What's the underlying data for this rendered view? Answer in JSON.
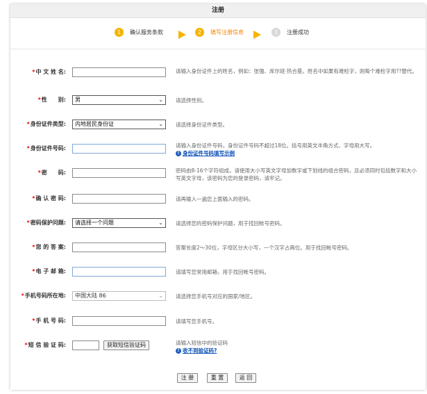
{
  "title": "注册",
  "steps": [
    {
      "num": "1",
      "label": "确认服务条款"
    },
    {
      "num": "2",
      "label": "填写注册信息"
    },
    {
      "num": "3",
      "label": "注册成功"
    }
  ],
  "fields": {
    "name": {
      "label": "中 文 姓 名:",
      "value": "",
      "hint": "请输入身份证件上的姓名，例如：张强、库尔班·热合曼。姓名中如果有难检字，则每个难检字用??替代。"
    },
    "gender": {
      "label": "性　　别:",
      "value": "男",
      "hint": "请选择性别。"
    },
    "id_type": {
      "label": "身份证件类型:",
      "value": "内地居民身份证",
      "hint": "请选择身份证件类型。"
    },
    "id_number": {
      "label": "身份证件号码:",
      "value": "",
      "hint": "请输入身份证件号码，身份证件号码不超过18位。括号用英文半角方式、字母用大写。",
      "link": "身份证件号码填写示例"
    },
    "password": {
      "label": "密　　码:",
      "value": "",
      "hint": "密码由8-16个字符组成，请使用大小写英文字母加数字或下划线的组合密码，且必须同时包括数字和大小写英文字母，该密码为您的登录密码，请牢记。"
    },
    "confirm_password": {
      "label": "确 认 密 码:",
      "value": "",
      "hint": "请再输入一遍您上面输入的密码。"
    },
    "security_question": {
      "label": "密码保护问题:",
      "value": "请选择一个问题",
      "hint": "请选择您的密码保护问题，用于找回帐号密码。"
    },
    "answer": {
      "label": "您 的 答 案:",
      "value": "",
      "hint": "答案长度2～30位，字母区分大小写，一个汉字占两位。用于找回帐号密码。"
    },
    "email": {
      "label": "电 子 邮 箱:",
      "value": "",
      "hint": "请填写您常用邮箱，用于找回帐号密码。"
    },
    "phone_region": {
      "label": "手机号码所在地:",
      "value": "中国大陆 86",
      "hint": "请选择您手机号对应的国家/地区。"
    },
    "phone": {
      "label": "手 机 号 码:",
      "value": "",
      "hint": "请填写您手机号。"
    },
    "sms_code": {
      "label": "短 信 验 证 码:",
      "value": "",
      "button": "获取短信验证码",
      "hint": "请输入短信中的验证码",
      "link": "收不到验证码?"
    }
  },
  "required_mark": "*",
  "buttons": {
    "submit": "注 册",
    "reset": "重 置",
    "back": "返 回"
  },
  "colors": {
    "accent": "#f6b400",
    "active_step": "#f08300",
    "link": "#0b4fb6",
    "required": "#ee0000"
  }
}
